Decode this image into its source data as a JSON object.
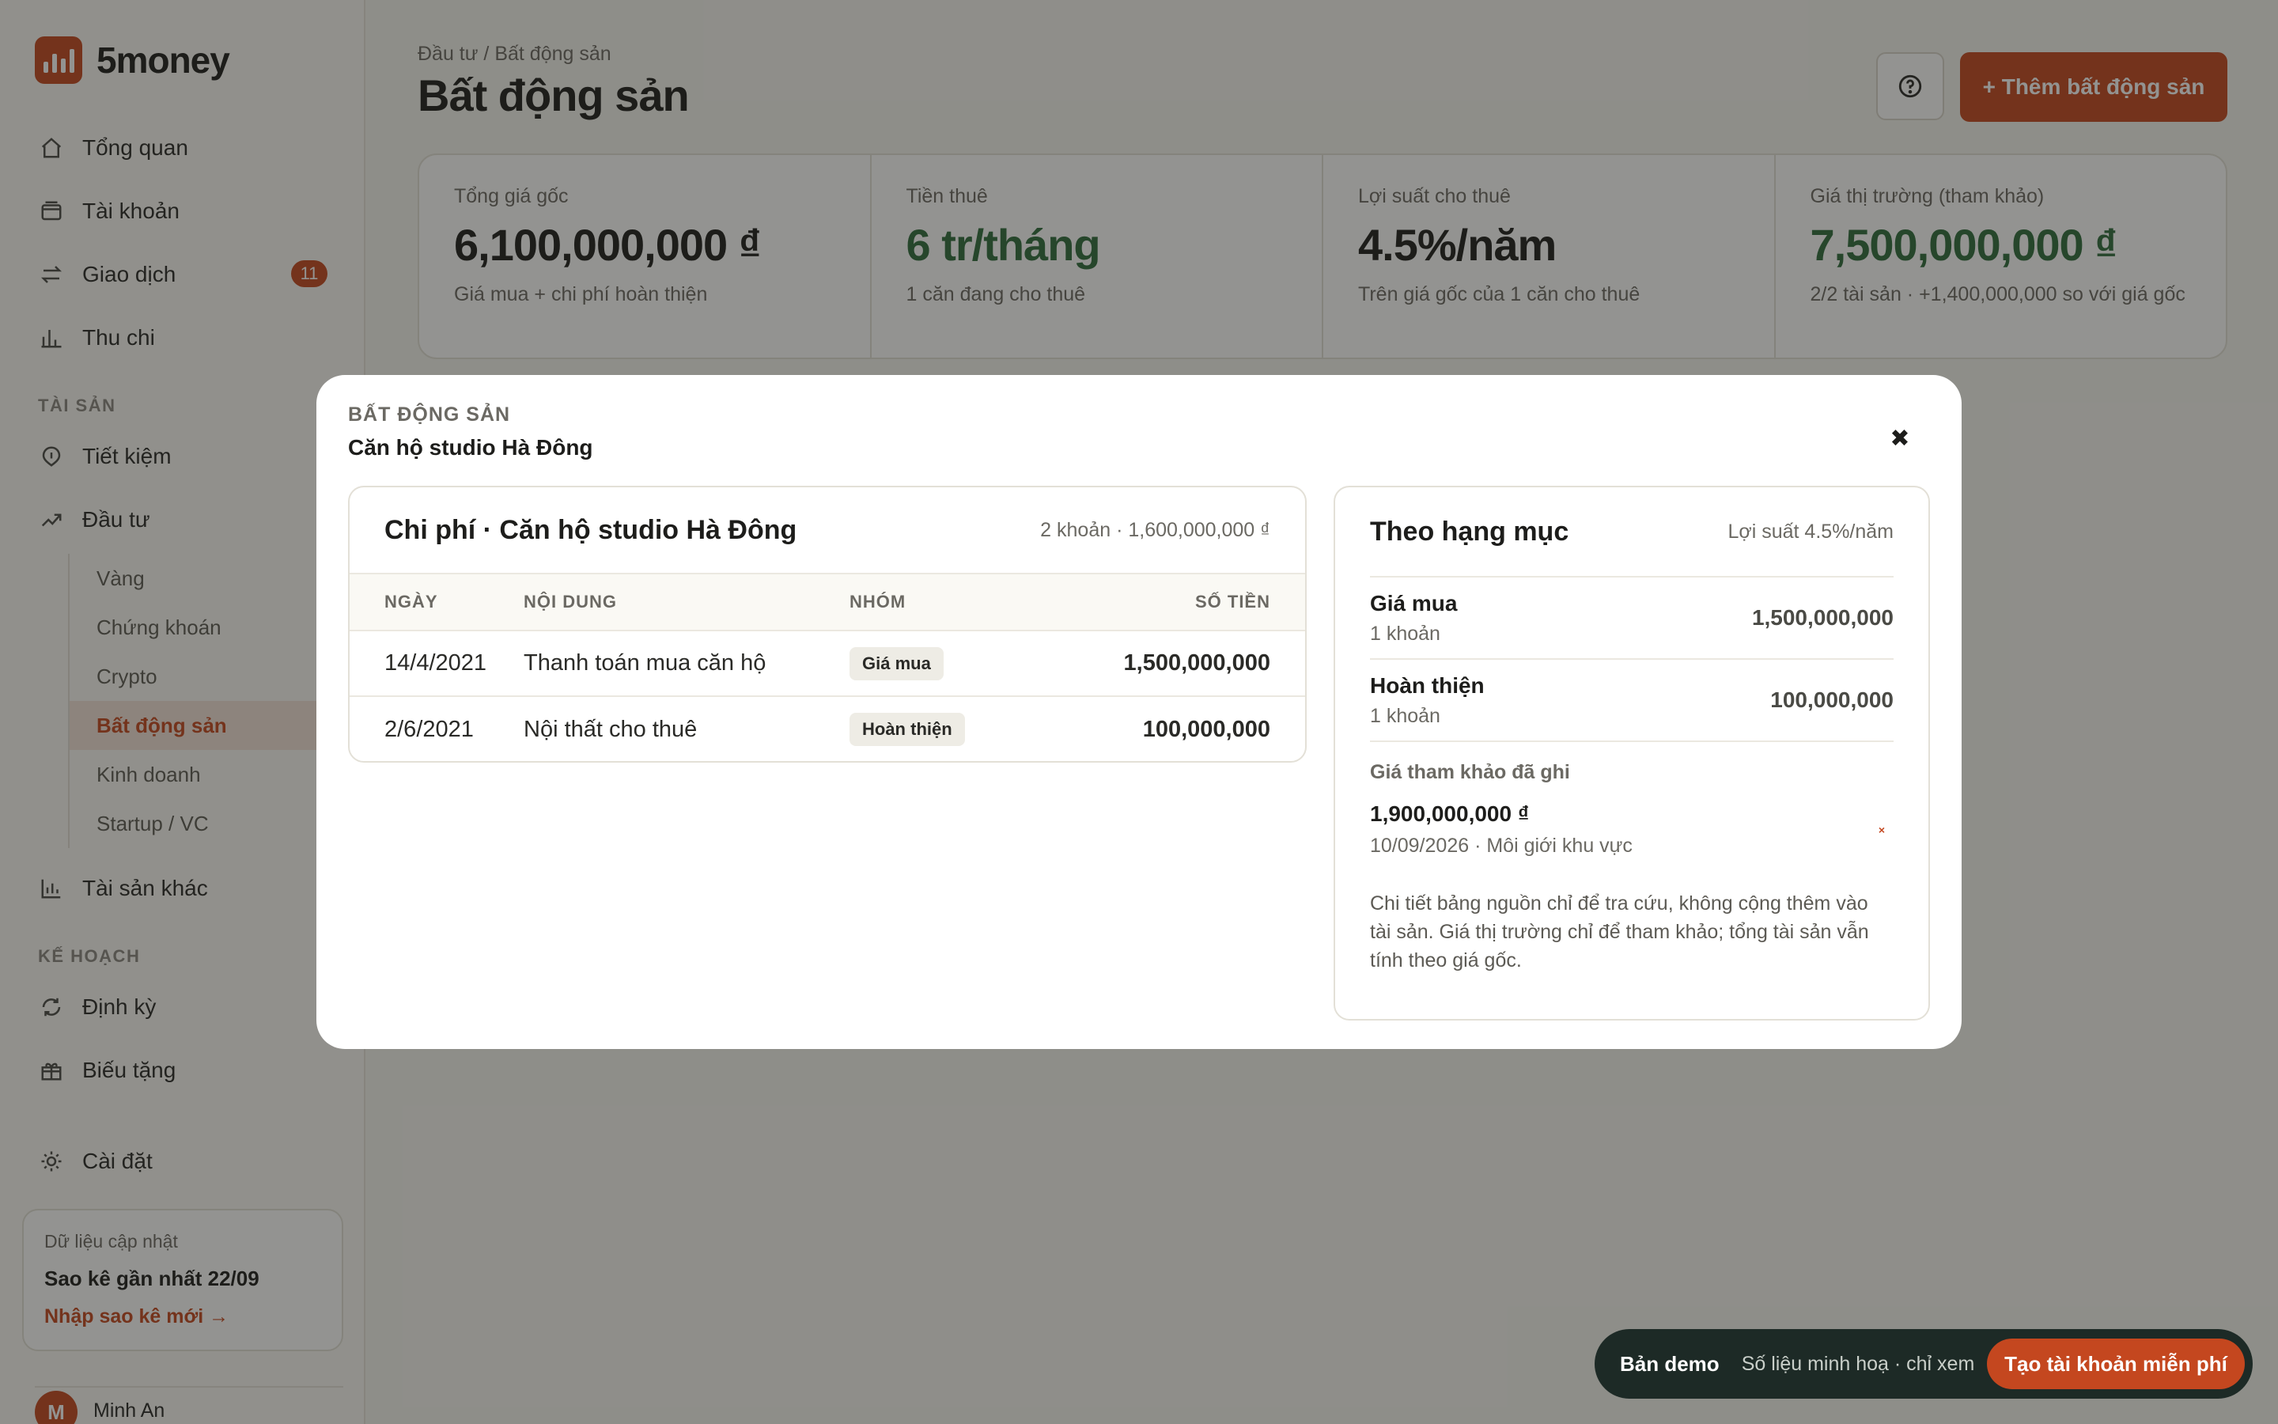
{
  "brand": {
    "name": "5money",
    "logo_icon": "bar-chart-logo-icon",
    "accent": "#c4471f"
  },
  "nav": {
    "main": [
      {
        "label": "Tổng quan",
        "icon": "home-icon"
      },
      {
        "label": "Tài khoản",
        "icon": "wallet-icon"
      },
      {
        "label": "Giao dịch",
        "icon": "transfer-icon",
        "badge": "11"
      },
      {
        "label": "Thu chi",
        "icon": "bar-chart-icon"
      }
    ],
    "section_assets": "TÀI SẢN",
    "assets": [
      {
        "label": "Tiết kiệm",
        "icon": "piggy-bank-icon"
      },
      {
        "label": "Đầu tư",
        "icon": "trend-up-icon"
      }
    ],
    "invest_sub": [
      "Vàng",
      "Chứng khoán",
      "Crypto",
      "Bất động sản",
      "Kinh doanh",
      "Startup / VC"
    ],
    "invest_sub_active": "Bất động sản",
    "other_assets": {
      "label": "Tài sản khác",
      "icon": "bar-chart-icon"
    },
    "section_plan": "KẾ HOẠCH",
    "plan": [
      {
        "label": "Định kỳ",
        "icon": "repeat-icon"
      },
      {
        "label": "Biếu tặng",
        "icon": "gift-icon"
      }
    ],
    "settings": {
      "label": "Cài đặt",
      "icon": "sun-gear-icon"
    }
  },
  "update_card": {
    "label": "Dữ liệu cập nhật",
    "title": "Sao kê gần nhất 22/09",
    "link": "Nhập sao kê mới →"
  },
  "user": {
    "initial": "M",
    "name": "Minh An"
  },
  "header": {
    "breadcrumb": "Đầu tư / Bất động sản",
    "title": "Bất động sản",
    "add_button": "+ Thêm bất động sản"
  },
  "stats": [
    {
      "label": "Tổng giá gốc",
      "value": "6,100,000,000 ₫",
      "sub": "Giá mua + chi phí hoàn thiện",
      "green": false
    },
    {
      "label": "Tiền thuê",
      "value": "6 tr/tháng",
      "sub": "1 căn đang cho thuê",
      "green": true
    },
    {
      "label": "Lợi suất cho thuê",
      "value": "4.5%/năm",
      "sub": "Trên giá gốc của 1 căn cho thuê",
      "green": false
    },
    {
      "label": "Giá thị trường (tham khảo)",
      "value": "7,500,000,000 ₫",
      "sub": "2/2 tài sản · +1,400,000,000 so với giá gốc",
      "green": true
    }
  ],
  "modal": {
    "kicker": "BẤT ĐỘNG SẢN",
    "title": "Căn hộ studio Hà Đông",
    "close": "✖",
    "costs": {
      "title": "Chi phí · Căn hộ studio Hà Đông",
      "meta": "2 khoản · 1,600,000,000 ₫",
      "columns": {
        "date": "NGÀY",
        "desc": "NỘI DUNG",
        "group": "NHÓM",
        "amount": "SỐ TIỀN"
      },
      "rows": [
        {
          "date": "14/4/2021",
          "desc": "Thanh toán mua căn hộ",
          "group": "Giá mua",
          "amount": "1,500,000,000"
        },
        {
          "date": "2/6/2021",
          "desc": "Nội thất cho thuê",
          "group": "Hoàn thiện",
          "amount": "100,000,000"
        }
      ]
    },
    "categories": {
      "title": "Theo hạng mục",
      "meta": "Lợi suất 4.5%/năm",
      "rows": [
        {
          "name": "Giá mua",
          "count": "1 khoản",
          "amount": "1,500,000,000"
        },
        {
          "name": "Hoàn thiện",
          "count": "1 khoản",
          "amount": "100,000,000"
        }
      ],
      "ref_label": "Giá tham khảo đã ghi",
      "ref_value": "1,900,000,000 ₫",
      "ref_meta": "10/09/2026 · Môi giới khu vực",
      "ref_delete": "×",
      "note": "Chi tiết bảng nguồn chỉ để tra cứu, không cộng thêm vào tài sản. Giá thị trường chỉ để tham khảo; tổng tài sản vẫn tính theo giá gốc."
    }
  },
  "demo_bar": {
    "tag": "Bản demo",
    "text": "Số liệu minh hoạ · chỉ xem",
    "cta": "Tạo tài khoản miễn phí"
  }
}
